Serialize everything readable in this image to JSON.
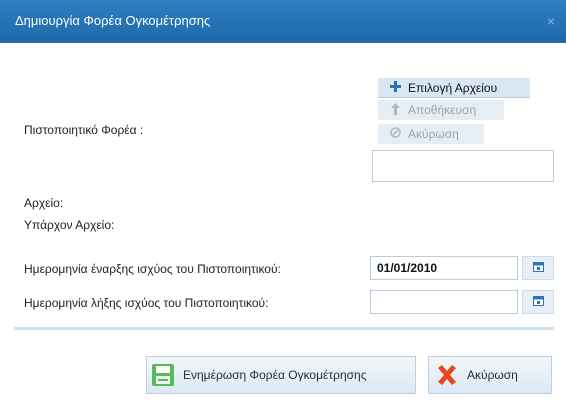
{
  "dialog": {
    "title": "Δημιουργία Φορέα Ογκομέτρησης",
    "close_symbol": "×"
  },
  "form": {
    "certificate_label": "Πιστοποιητικό Φορέα :",
    "file_label": "Αρχείο:",
    "existing_file_label": "Υπάρχον Αρχείο:",
    "start_date_label": "Ημερομηνία έναρξης ισχύος του Πιστοποιητικού:",
    "start_date_value": "01/01/2010",
    "end_date_label": "Ημερομηνία λήξης ισχύος του Πιστοποιητικού:",
    "end_date_value": ""
  },
  "file_actions": {
    "select": {
      "label": "Επιλογή Αρχείου",
      "icon": "plus-icon",
      "color": "#2e73b8"
    },
    "save": {
      "label": "Αποθήκευση",
      "icon": "upload-icon",
      "state": "disabled"
    },
    "cancel": {
      "label": "Ακύρωση",
      "icon": "cancel-circle-icon",
      "state": "disabled"
    }
  },
  "footer": {
    "update_button_label": "Ενημέρωση Φορέα Ογκομέτρησης",
    "update_icon": "save-icon",
    "update_icon_color": "#5cb85c",
    "cancel_button_label": "Ακύρωση",
    "cancel_icon": "close-x-icon",
    "cancel_icon_color": "#e8461f"
  },
  "colors": {
    "titlebar": "#2574b5",
    "accent": "#2e73b8"
  }
}
